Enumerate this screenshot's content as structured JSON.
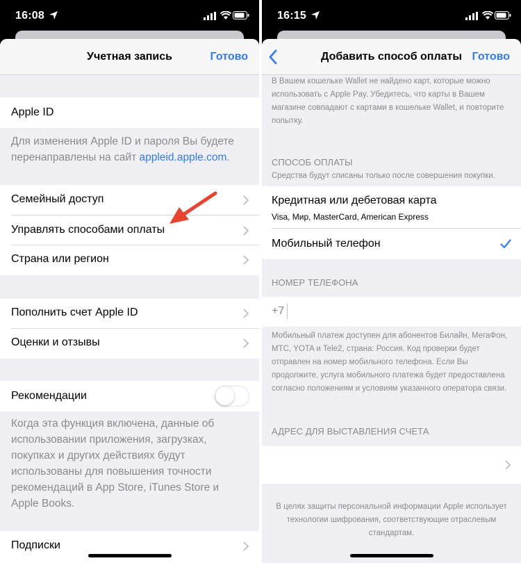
{
  "left": {
    "status": {
      "time": "16:08"
    },
    "nav": {
      "title": "Учетная запись",
      "done": "Готово"
    },
    "apple_id": {
      "label": "Apple ID"
    },
    "apple_id_footer": {
      "text": "Для изменения Apple ID и пароля Вы будете перенаправлены на сайт ",
      "link": "appleid.apple.com",
      "end": "."
    },
    "group1": [
      "Семейный доступ",
      "Управлять способами оплаты",
      "Страна или регион"
    ],
    "group2": [
      "Пополнить счет Apple ID",
      "Оценки и отзывы"
    ],
    "recommendations": {
      "label": "Рекомендации",
      "enabled": false
    },
    "recommendations_footer": "Когда эта функция включена, данные об использовании приложения, загрузках, покупках и других действиях будут использованы для повышения точности рекомендаций в App Store, iTunes Store и Apple Books.",
    "subscriptions": "Подписки"
  },
  "right": {
    "status": {
      "time": "16:15"
    },
    "nav": {
      "title": "Добавить способ оплаты",
      "done": "Готово"
    },
    "wallet_note": "В Вашем кошельке Wallet не найдено карт, которые можно использовать с Apple Pay. Убедитесь, что карты в Вашем магазине совпадают с картами в кошельке Wallet, и повторите попытку.",
    "payment_header": "СПОСОБ ОПЛАТЫ",
    "payment_subnote": "Средства будут списаны только после совершения покупки.",
    "card_option": {
      "title": "Кредитная или дебетовая карта",
      "subtitle": "Visa, Мир, MasterCard, American Express"
    },
    "mobile_option": {
      "title": "Мобильный телефон",
      "selected": true
    },
    "phone_header": "НОМЕР ТЕЛЕФОНА",
    "phone_prefix": "+7",
    "phone_note": "Мобильный платеж доступен для абонентов Билайн, МегаФон, МТС, YOTA и Tele2, страна: Россия. Код проверки будет отправлен на номер мобильного телефона. Если Вы продолжите, услуга мобильного платежа будет предоставлена согласно положениям и условиям указанного оператора связи.",
    "billing_header": "АДРЕС ДЛЯ ВЫСТАВЛЕНИЯ СЧЕТА",
    "privacy_note": "В целях защиты персональной информации Apple использует технологии шифрования, соответствующие отраслевым стандартам."
  },
  "colors": {
    "accent": "#2f7cf6",
    "arrow": "#e8432f",
    "background": "#efeff4"
  }
}
